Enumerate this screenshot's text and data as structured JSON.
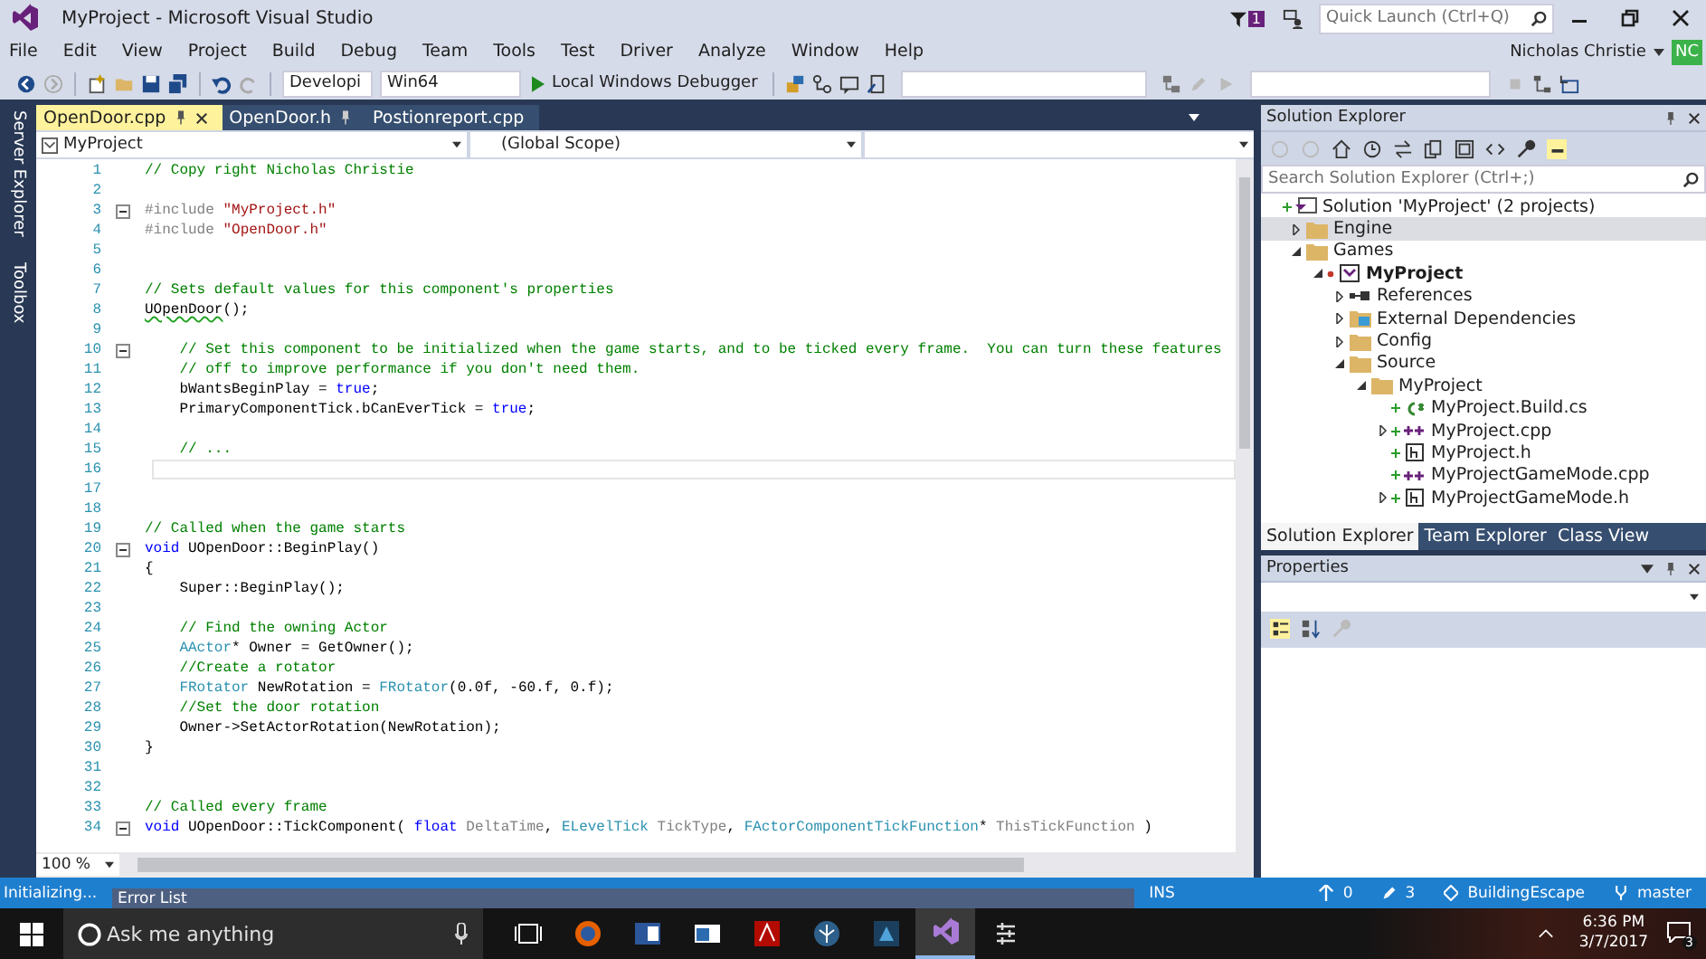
{
  "window": {
    "title": "MyProject - Microsoft Visual Studio",
    "notification_count": "1",
    "quick_launch_placeholder": "Quick Launch (Ctrl+Q)",
    "user": "Nicholas Christie",
    "user_initials": "NC"
  },
  "menu": [
    "File",
    "Edit",
    "View",
    "Project",
    "Build",
    "Debug",
    "Team",
    "Tools",
    "Test",
    "Driver",
    "Analyze",
    "Window",
    "Help"
  ],
  "toolbar": {
    "configuration": "Developi",
    "platform": "Win64",
    "debugger": "Local Windows Debugger"
  },
  "side_tabs": [
    "Server Explorer",
    "Toolbox"
  ],
  "editor": {
    "tabs": [
      {
        "label": "OpenDoor.cpp",
        "selected": true,
        "pinned": true
      },
      {
        "label": "OpenDoor.h",
        "selected": false,
        "pinned": true
      },
      {
        "label": "Postionreport.cpp",
        "selected": false,
        "pinned": false
      }
    ],
    "project_scope": "MyProject",
    "global_scope": "(Global Scope)",
    "zoom": "100 %",
    "lines": [
      {
        "n": "1",
        "tokens": [
          {
            "kind": "comment",
            "t": "// Copy right Nicholas Christie"
          }
        ]
      },
      {
        "n": "2"
      },
      {
        "n": "3",
        "fold": true,
        "tokens": [
          {
            "kind": "preproc",
            "t": "#include "
          },
          {
            "kind": "string",
            "t": "\"MyProject.h\""
          }
        ]
      },
      {
        "n": "4",
        "tokens": [
          {
            "kind": "preproc",
            "t": "#include "
          },
          {
            "kind": "string",
            "t": "\"OpenDoor.h\""
          }
        ]
      },
      {
        "n": "5"
      },
      {
        "n": "6"
      },
      {
        "n": "7",
        "tokens": [
          {
            "kind": "comment",
            "t": "// Sets default values for this component's properties"
          }
        ]
      },
      {
        "n": "8",
        "tokens": [
          {
            "kind": "error",
            "t": "UOpenDoor"
          },
          {
            "kind": "plain",
            "t": "();"
          }
        ]
      },
      {
        "n": "9"
      },
      {
        "n": "10",
        "fold": true,
        "tokens": [
          {
            "kind": "comment",
            "t": "    // Set this component to be initialized when the game starts, and to be ticked every frame.  You can turn these features"
          }
        ]
      },
      {
        "n": "11",
        "tokens": [
          {
            "kind": "comment",
            "t": "    // off to improve performance if you don't need them."
          }
        ]
      },
      {
        "n": "12",
        "tokens": [
          {
            "kind": "plain",
            "t": "    bWantsBeginPlay = "
          },
          {
            "kind": "keyword",
            "t": "true"
          },
          {
            "kind": "plain",
            "t": ";"
          }
        ]
      },
      {
        "n": "13",
        "tokens": [
          {
            "kind": "plain",
            "t": "    PrimaryComponentTick.bCanEverTick = "
          },
          {
            "kind": "keyword",
            "t": "true"
          },
          {
            "kind": "plain",
            "t": ";"
          }
        ]
      },
      {
        "n": "14"
      },
      {
        "n": "15",
        "tokens": [
          {
            "kind": "comment",
            "t": "    // ..."
          }
        ]
      },
      {
        "n": "16",
        "current": true
      },
      {
        "n": "17"
      },
      {
        "n": "18"
      },
      {
        "n": "19",
        "tokens": [
          {
            "kind": "comment",
            "t": "// Called when the game starts"
          }
        ]
      },
      {
        "n": "20",
        "fold": true,
        "tokens": [
          {
            "kind": "keyword",
            "t": "void"
          },
          {
            "kind": "plain",
            "t": " UOpenDoor::BeginPlay()"
          }
        ]
      },
      {
        "n": "21",
        "tokens": [
          {
            "kind": "plain",
            "t": "{"
          }
        ]
      },
      {
        "n": "22",
        "tokens": [
          {
            "kind": "plain",
            "t": "    Super::BeginPlay();"
          }
        ]
      },
      {
        "n": "23"
      },
      {
        "n": "24",
        "tokens": [
          {
            "kind": "comment",
            "t": "    // Find the owning Actor"
          }
        ]
      },
      {
        "n": "25",
        "tokens": [
          {
            "kind": "type",
            "t": "    AActor"
          },
          {
            "kind": "plain",
            "t": "* Owner = GetOwner();"
          }
        ]
      },
      {
        "n": "26",
        "tokens": [
          {
            "kind": "comment",
            "t": "    //Create a rotator"
          }
        ]
      },
      {
        "n": "27",
        "tokens": [
          {
            "kind": "type",
            "t": "    FRotator"
          },
          {
            "kind": "plain",
            "t": " NewRotation = "
          },
          {
            "kind": "type",
            "t": "FRotator"
          },
          {
            "kind": "plain",
            "t": "(0.0f, -60.f, 0.f);"
          }
        ]
      },
      {
        "n": "28",
        "tokens": [
          {
            "kind": "comment",
            "t": "    //Set the door rotation"
          }
        ]
      },
      {
        "n": "29",
        "tokens": [
          {
            "kind": "plain",
            "t": "    Owner->SetActorRotation(NewRotation);"
          }
        ]
      },
      {
        "n": "30",
        "tokens": [
          {
            "kind": "plain",
            "t": "}"
          }
        ]
      },
      {
        "n": "31"
      },
      {
        "n": "32"
      },
      {
        "n": "33",
        "tokens": [
          {
            "kind": "comment",
            "t": "// Called every frame"
          }
        ]
      },
      {
        "n": "34",
        "fold": true,
        "tokens": [
          {
            "kind": "keyword",
            "t": "void"
          },
          {
            "kind": "plain",
            "t": " UOpenDoor::TickComponent( "
          },
          {
            "kind": "keyword",
            "t": "float"
          },
          {
            "kind": "param",
            "t": " DeltaTime"
          },
          {
            "kind": "plain",
            "t": ", "
          },
          {
            "kind": "type",
            "t": "ELevelTick"
          },
          {
            "kind": "param",
            "t": " TickType"
          },
          {
            "kind": "plain",
            "t": ", "
          },
          {
            "kind": "type",
            "t": "FActorComponentTickFunction"
          },
          {
            "kind": "plain",
            "t": "* "
          },
          {
            "kind": "param",
            "t": "ThisTickFunction"
          },
          {
            "kind": "plain",
            "t": " )"
          }
        ]
      }
    ]
  },
  "solution_explorer": {
    "title": "Solution Explorer",
    "search_placeholder": "Search Solution Explorer (Ctrl+;)",
    "tree": [
      {
        "label": "Solution 'MyProject' (2 projects)",
        "kind": "solution",
        "git_added": true,
        "selected": false,
        "children": [
          {
            "label": "Engine",
            "kind": "folder",
            "expanded": false,
            "selected": true
          },
          {
            "label": "Games",
            "kind": "folder",
            "expanded": true,
            "selected": false,
            "children": [
              {
                "label": "MyProject",
                "kind": "project",
                "git_modified": true,
                "expanded": true,
                "selected": false,
                "children": [
                  {
                    "label": "References",
                    "kind": "references",
                    "expanded": false,
                    "selected": false
                  },
                  {
                    "label": "External Dependencies",
                    "kind": "dependencies",
                    "expanded": false,
                    "selected": false
                  },
                  {
                    "label": "Config",
                    "kind": "folder",
                    "expanded": false,
                    "selected": false
                  },
                  {
                    "label": "Source",
                    "kind": "folder",
                    "expanded": true,
                    "selected": false,
                    "children": [
                      {
                        "label": "MyProject",
                        "kind": "folder",
                        "expanded": true,
                        "selected": false,
                        "children": [
                          {
                            "label": "MyProject.Build.cs",
                            "kind": "cs",
                            "git_added": true,
                            "selected": false
                          },
                          {
                            "label": "MyProject.cpp",
                            "kind": "cpp",
                            "git_added": true,
                            "expanded": false,
                            "selected": false
                          },
                          {
                            "label": "MyProject.h",
                            "kind": "h",
                            "git_added": true,
                            "selected": false
                          },
                          {
                            "label": "MyProjectGameMode.cpp",
                            "kind": "cpp",
                            "git_added": true,
                            "selected": false
                          },
                          {
                            "label": "MyProjectGameMode.h",
                            "kind": "h",
                            "git_added": true,
                            "expanded": false,
                            "selected": false
                          }
                        ]
                      }
                    ]
                  }
                ]
              }
            ]
          }
        ]
      }
    ],
    "tabs": [
      {
        "label": "Solution Explorer",
        "selected": true
      },
      {
        "label": "Team Explorer",
        "selected": false
      },
      {
        "label": "Class View",
        "selected": false
      }
    ]
  },
  "properties": {
    "title": "Properties"
  },
  "error_list": {
    "title": "Error List"
  },
  "status_bar": {
    "message": "Initializing...",
    "mode": "INS",
    "pushes": "0",
    "changes": "3",
    "repository": "BuildingEscape",
    "branch": "master"
  },
  "taskbar": {
    "search_placeholder": "Ask me anything",
    "time": "6:36 PM",
    "date": "3/7/2017",
    "notifications": "3",
    "apps": [
      {
        "kind": "taskview",
        "active": false
      },
      {
        "kind": "firefox",
        "active": false
      },
      {
        "kind": "word",
        "active": false
      },
      {
        "kind": "window",
        "active": false
      },
      {
        "kind": "acrobat",
        "active": false
      },
      {
        "kind": "circle",
        "active": false
      },
      {
        "kind": "ps",
        "active": false
      },
      {
        "kind": "vs",
        "active": true
      },
      {
        "kind": "tool",
        "active": false
      }
    ]
  }
}
